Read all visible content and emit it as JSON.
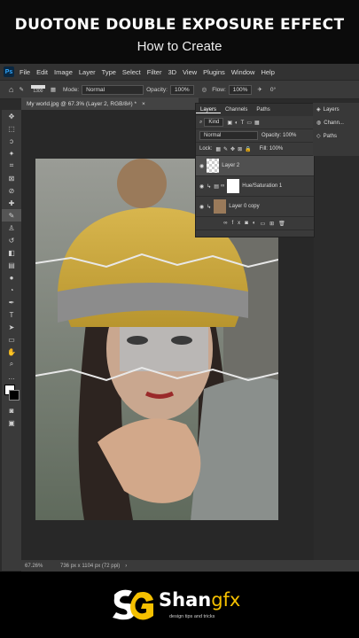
{
  "banner": {
    "title": "DUOTONE DOUBLE EXPOSURE EFFECT",
    "subtitle": "How to Create"
  },
  "menubar": {
    "logo": "Ps",
    "items": [
      "File",
      "Edit",
      "Image",
      "Layer",
      "Type",
      "Select",
      "Filter",
      "3D",
      "View",
      "Plugins",
      "Window",
      "Help"
    ]
  },
  "optionsbar": {
    "brush_size": "1300",
    "mode_label": "Mode:",
    "mode_value": "Normal",
    "opacity_label": "Opacity:",
    "opacity_value": "100%",
    "flow_label": "Flow:",
    "flow_value": "100%",
    "angle": "0°"
  },
  "document_tab": {
    "label": "My world.jpg @ 67.3% (Layer 2, RGB/8#) *",
    "close": "×"
  },
  "layers_panel": {
    "tabs": [
      "Layers",
      "Channels",
      "Paths"
    ],
    "kind_label": "Kind",
    "blend_mode": "Normal",
    "opacity_label": "Opacity:",
    "opacity_value": "100%",
    "lock_label": "Lock:",
    "fill_label": "Fill:",
    "fill_value": "100%",
    "layers": [
      {
        "name": "Layer 2"
      },
      {
        "name": "Hue/Saturation 1"
      },
      {
        "name": "Layer 0 copy"
      }
    ],
    "footer_fx": "fx"
  },
  "right_panel": {
    "items": [
      "Layers",
      "Chann...",
      "Paths"
    ]
  },
  "statusbar": {
    "zoom": "67.26%",
    "doc_info": "736 px x 1104 px (72 ppi)"
  },
  "brand": {
    "name": "Shan",
    "suffix": "gfx",
    "tagline": "design tips and tricks",
    "mark": "SG"
  },
  "colors": {
    "accent": "#f5c000",
    "ps_blue": "#31a8ff",
    "panel": "#3a3a3a"
  }
}
